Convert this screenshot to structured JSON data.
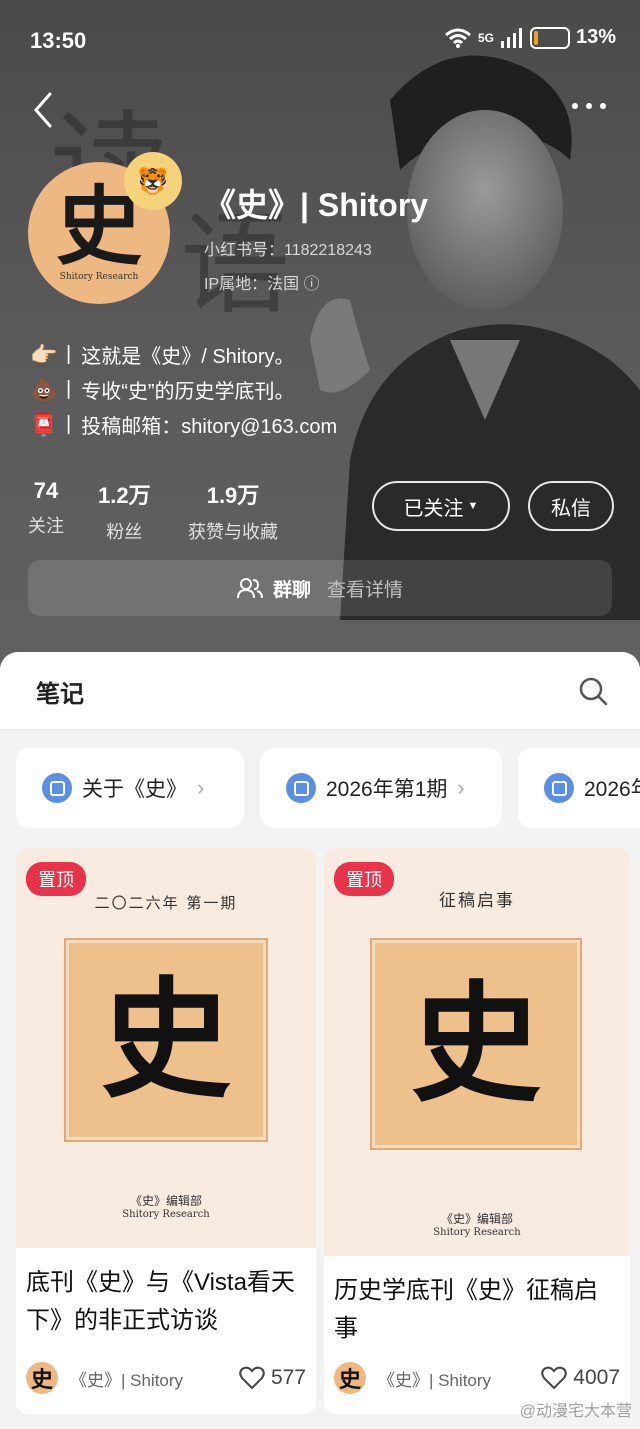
{
  "status_bar": {
    "time": "13:50",
    "network": "5G",
    "battery_text": "13%",
    "battery_level": 0.13
  },
  "profile": {
    "avatar_char": "史",
    "avatar_sub": "Shitory Research",
    "name": "《史》| Shitory",
    "id_text": "小红书号：1182218243",
    "ip_text": "IP属地：法国 ⓘ",
    "bio": [
      {
        "icon": "👉🏻",
        "text": "这就是《史》/ Shitory。"
      },
      {
        "icon": "💩",
        "text": "专收“史”的历史学底刊。"
      },
      {
        "icon": "📮",
        "text": "投稿邮箱：shitory@163.com"
      }
    ],
    "stats": [
      {
        "num": "74",
        "label": "关注"
      },
      {
        "num": "1.2万",
        "label": "粉丝"
      },
      {
        "num": "1.9万",
        "label": "获赞与收藏"
      }
    ],
    "follow_btn": "已关注",
    "message_btn": "私信",
    "group_label": "群聊",
    "group_detail": "查看详情"
  },
  "tabs": {
    "notes": "笔记"
  },
  "collections": [
    {
      "label": "关于《史》"
    },
    {
      "label": "2026年第1期"
    },
    {
      "label": "2026年"
    }
  ],
  "notes": [
    {
      "pin": "置顶",
      "cover_head": "二〇二六年 第一期",
      "cover_char": "史",
      "cover_foot_a": "《史》编辑部",
      "cover_foot_b": "Shitory Research",
      "title": "底刊《史》与《Vista看天下》的非正式访谈",
      "author": "《史》| Shitory",
      "likes": "577"
    },
    {
      "pin": "置顶",
      "cover_head": "征稿启事",
      "cover_char": "史",
      "cover_foot_a": "《史》编辑部",
      "cover_foot_b": "Shitory Research",
      "title": "历史学底刊《史》征稿启事",
      "author": "《史》| Shitory",
      "likes": "4007"
    }
  ],
  "watermark": "@动漫宅大本营",
  "colors": {
    "pin": "#e8344a",
    "collection_icon": "#5b8fe6",
    "cover_square": "#eec08c"
  }
}
